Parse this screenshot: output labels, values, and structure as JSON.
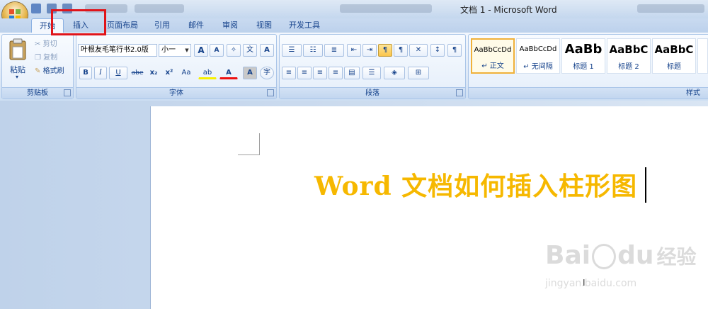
{
  "window": {
    "title": "文档 1 - Microsoft Word"
  },
  "tabs": [
    {
      "label": "开始"
    },
    {
      "label": "插入"
    },
    {
      "label": "页面布局"
    },
    {
      "label": "引用"
    },
    {
      "label": "邮件"
    },
    {
      "label": "审阅"
    },
    {
      "label": "视图"
    },
    {
      "label": "开发工具"
    }
  ],
  "clipboard": {
    "paste": "粘贴",
    "cut": "剪切",
    "copy": "复制",
    "format_painter": "格式刷",
    "label": "剪贴板"
  },
  "font": {
    "family": "叶根友毛笔行书2.0版",
    "size": "小一",
    "label": "字体",
    "bold": "B",
    "italic": "I",
    "underline": "U",
    "strike": "abe",
    "subscript": "x₂",
    "superscript": "x²",
    "change_case": "Aa",
    "grow": "A",
    "shrink": "A",
    "highlight": "ab",
    "color": "A",
    "shade": "A",
    "enclose": "字"
  },
  "paragraph": {
    "label": "段落"
  },
  "styles": {
    "label": "样式",
    "items": [
      {
        "sample": "AaBbCcDd",
        "name": "↵ 正文"
      },
      {
        "sample": "AaBbCcDd",
        "name": "↵ 无间隔"
      },
      {
        "sample": "AaBb",
        "name": "标题 1"
      },
      {
        "sample": "AaBbC",
        "name": "标题 2"
      },
      {
        "sample": "AaBbC",
        "name": "标题"
      }
    ]
  },
  "document": {
    "text": "Word 文档如何插入柱形图"
  },
  "watermark": {
    "brand": "Bai",
    "brand2": "du",
    "cn": "经验",
    "url": "jingyan.baidu.com"
  },
  "colors": {
    "accent_text": "#f6b800",
    "highlight_box": "#e0141a"
  }
}
